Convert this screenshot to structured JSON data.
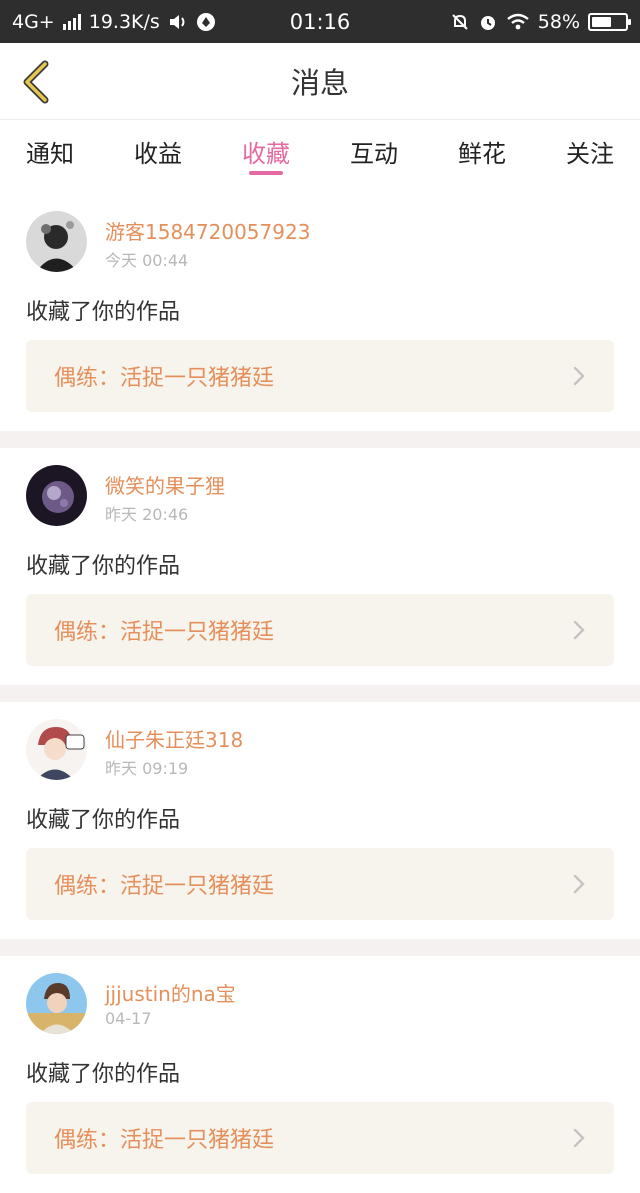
{
  "status_bar": {
    "network": "4G+",
    "speed": "19.3K/s",
    "time": "01:16",
    "battery_pct": "58%",
    "battery_level": 0.58,
    "icons": [
      "signal-icon",
      "volume-icon",
      "app-icon",
      "mute-bell-icon",
      "alarm-icon",
      "wifi-icon",
      "battery-icon"
    ]
  },
  "nav": {
    "title": "消息",
    "back_icon": "chevron-left-icon",
    "accent_color": "#e5c64e"
  },
  "tabs": [
    {
      "label": "通知"
    },
    {
      "label": "收益"
    },
    {
      "label": "收藏",
      "active": true
    },
    {
      "label": "互动"
    },
    {
      "label": "鲜花"
    },
    {
      "label": "关注"
    }
  ],
  "theme": {
    "active_tab_color": "#e56aa2",
    "username_color": "#e58f5b",
    "link_bg": "#f6f4ec"
  },
  "messages": [
    {
      "user": "游客1584720057923",
      "time": "今天 00:44",
      "action": "收藏了你的作品",
      "work": "偶练：活捉一只猪猪廷"
    },
    {
      "user": "微笑的果子狸",
      "time": "昨天 20:46",
      "action": "收藏了你的作品",
      "work": "偶练：活捉一只猪猪廷"
    },
    {
      "user": "仙子朱正廷318",
      "time": "昨天 09:19",
      "action": "收藏了你的作品",
      "work": "偶练：活捉一只猪猪廷"
    },
    {
      "user": "jjjustin的na宝",
      "time": "04-17",
      "action": "收藏了你的作品",
      "work": "偶练：活捉一只猪猪廷"
    }
  ]
}
